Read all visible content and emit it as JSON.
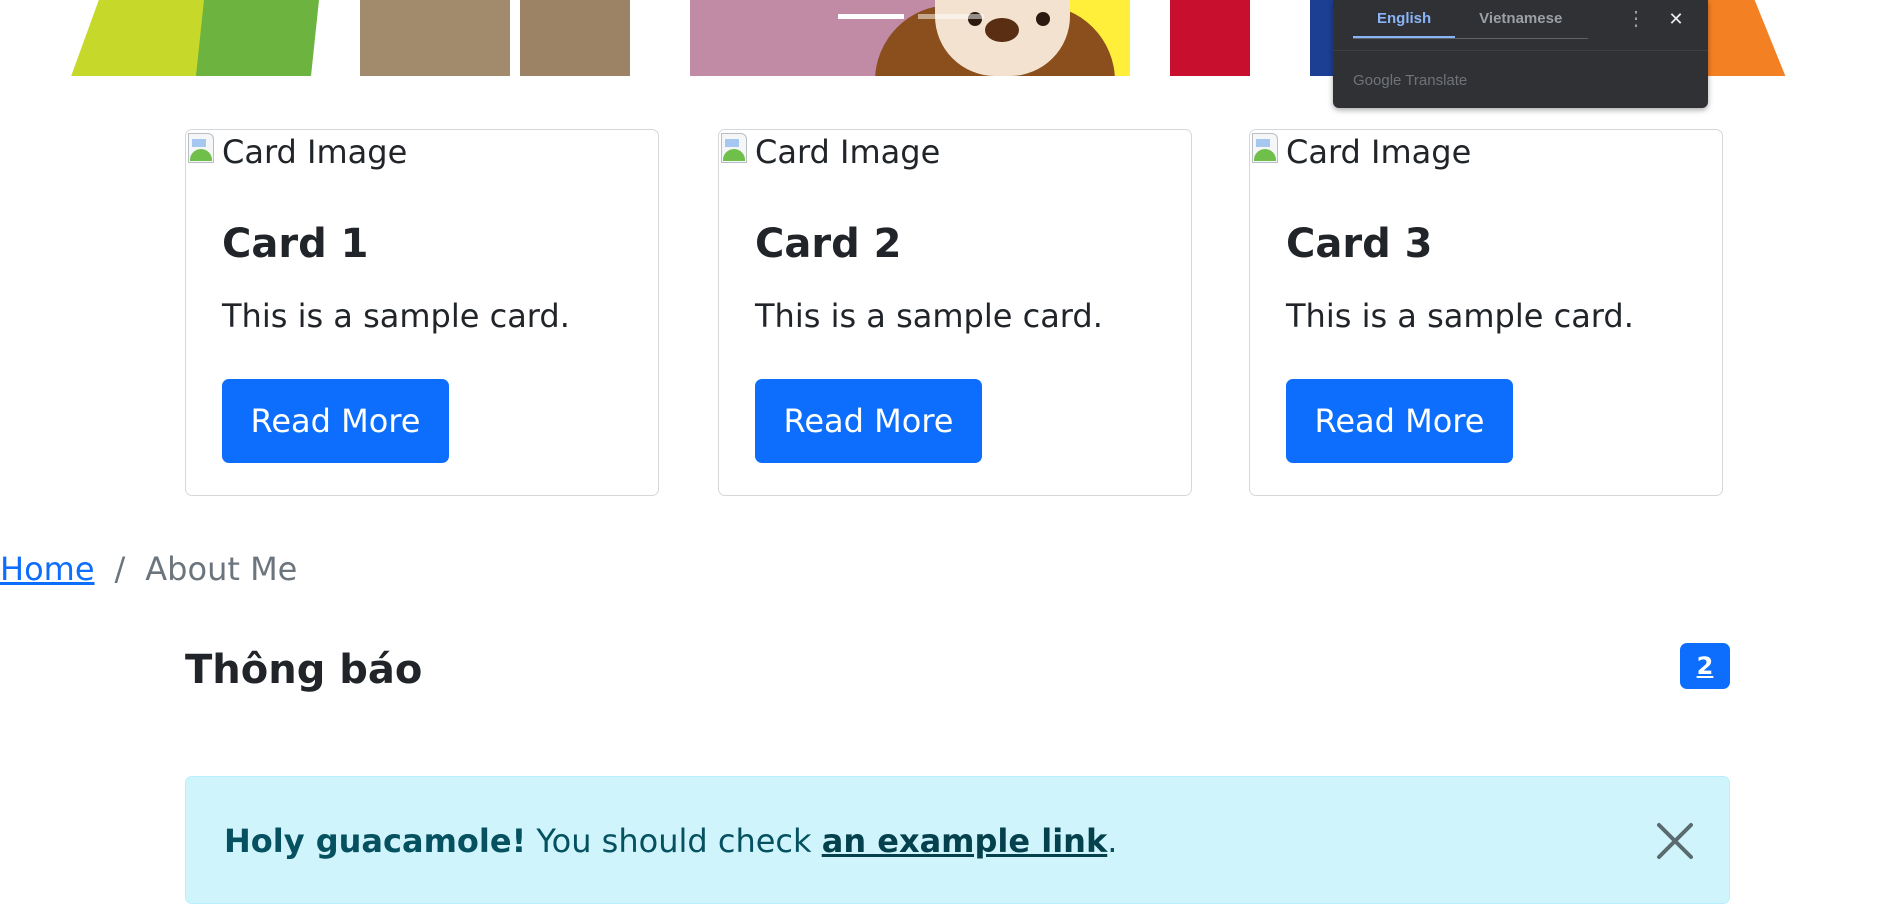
{
  "carousel": {
    "indicators": [
      {
        "label": "Slide 1",
        "active": true
      },
      {
        "label": "Slide 2",
        "active": false
      }
    ]
  },
  "translate_popup": {
    "tabs": [
      {
        "label": "English",
        "active": true
      },
      {
        "label": "Vietnamese",
        "active": false
      }
    ],
    "menu_icon": "more-vert-icon",
    "close_icon": "close-icon",
    "brand": "Google Translate",
    "brand_parts": {
      "google": "Google",
      "translate": "Translate"
    }
  },
  "cards": [
    {
      "image_alt": "Card Image",
      "title": "Card 1",
      "text": "This is a sample card.",
      "button": "Read More"
    },
    {
      "image_alt": "Card Image",
      "title": "Card 2",
      "text": "This is a sample card.",
      "button": "Read More"
    },
    {
      "image_alt": "Card Image",
      "title": "Card 3",
      "text": "This is a sample card.",
      "button": "Read More"
    }
  ],
  "breadcrumb": {
    "items": [
      {
        "label": "Home",
        "link": true
      },
      {
        "label": "About Me",
        "link": false
      }
    ],
    "separator": "/"
  },
  "notifications": {
    "title": "Thông báo",
    "count": "2"
  },
  "alert": {
    "strong": "Holy guacamole!",
    "text": " You should check ",
    "link": "an example link",
    "end": ".",
    "close_icon": "close-icon"
  },
  "colors": {
    "primary": "#0d6efd",
    "alert_bg": "#cff4fc",
    "alert_text": "#055160",
    "popup_bg": "#303134",
    "popup_accent": "#8ab4f8"
  }
}
